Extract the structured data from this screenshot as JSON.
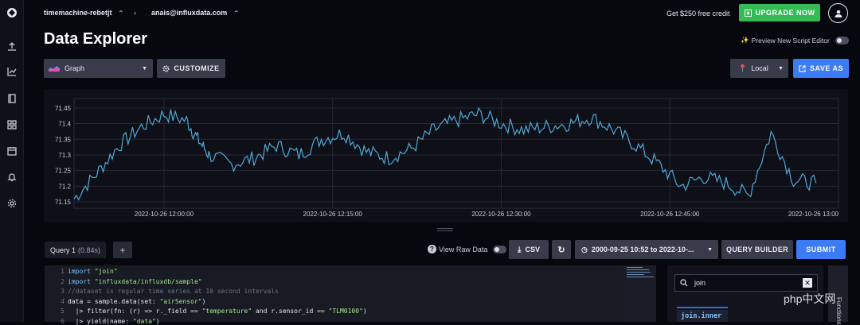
{
  "topbar": {
    "org": "timemachine-rebetjt",
    "account": "anais@influxdata.com",
    "credit_text": "Get $250 free credit",
    "upgrade_label": "UPGRADE NOW"
  },
  "page": {
    "title": "Data Explorer",
    "preview_label": "Preview New Script Editor"
  },
  "toolbar": {
    "view_type": "Graph",
    "customize_label": "CUSTOMIZE",
    "timezone": "Local",
    "save_label": "SAVE AS"
  },
  "chart_data": {
    "type": "line",
    "title": "",
    "xlabel": "",
    "ylabel": "",
    "x_ticks": [
      "2022-10-26 12:00:00",
      "2022-10-26 12:15:00",
      "2022-10-26 12:30:00",
      "2022-10-26 12:45:00",
      "2022-10-26 13:00"
    ],
    "y_ticks": [
      "71.45",
      "71.4",
      "71.35",
      "71.3",
      "71.25",
      "71.2",
      "71.15"
    ],
    "ylim": [
      71.13,
      71.48
    ],
    "grid": true,
    "color": "#4fa9d6",
    "series": [
      {
        "name": "",
        "x_minutes_from_1152": [
          0,
          2,
          4,
          6,
          8,
          10,
          11,
          12,
          14,
          16,
          18,
          20,
          22,
          24,
          26,
          28,
          30,
          32,
          34,
          36,
          38,
          40,
          42,
          44,
          46,
          48,
          50,
          52,
          54,
          56,
          58,
          60,
          62,
          64,
          66
        ],
        "values": [
          71.16,
          71.24,
          71.33,
          71.39,
          71.43,
          71.41,
          71.35,
          71.3,
          71.27,
          71.29,
          71.33,
          71.3,
          71.35,
          71.37,
          71.31,
          71.29,
          71.32,
          71.38,
          71.41,
          71.43,
          71.4,
          71.38,
          71.39,
          71.4,
          71.42,
          71.38,
          71.33,
          71.27,
          71.2,
          71.23,
          71.21,
          71.17,
          71.37,
          71.22,
          71.21
        ]
      }
    ]
  },
  "query": {
    "tab_label": "Query 1",
    "tab_duration": "(0.84s)",
    "add_label": "+",
    "view_raw_label": "View Raw Data",
    "csv_label": "CSV",
    "time_range": "2000-09-25 10:52 to 2022-10-...",
    "builder_label": "QUERY BUILDER",
    "submit_label": "SUBMIT"
  },
  "editor": {
    "lines": [
      {
        "n": "1",
        "text": "import \"join\""
      },
      {
        "n": "2",
        "text": "import \"influxdata/influxdb/sample\""
      },
      {
        "n": "3",
        "text": "//dataset is regular time series at 10 second intervals"
      },
      {
        "n": "4",
        "text": "data = sample.data(set: \"airSensor\")"
      },
      {
        "n": "5",
        "text": "  |> filter(fn: (r) => r._field == \"temperature\" and r.sensor_id == \"TLM0100\")"
      },
      {
        "n": "6",
        "text": "  |> yield(name: \"data\")"
      }
    ]
  },
  "functions": {
    "search_value": "join",
    "result_item": "join.inner",
    "tab_label": "Functions"
  },
  "watermark": "php中文网"
}
